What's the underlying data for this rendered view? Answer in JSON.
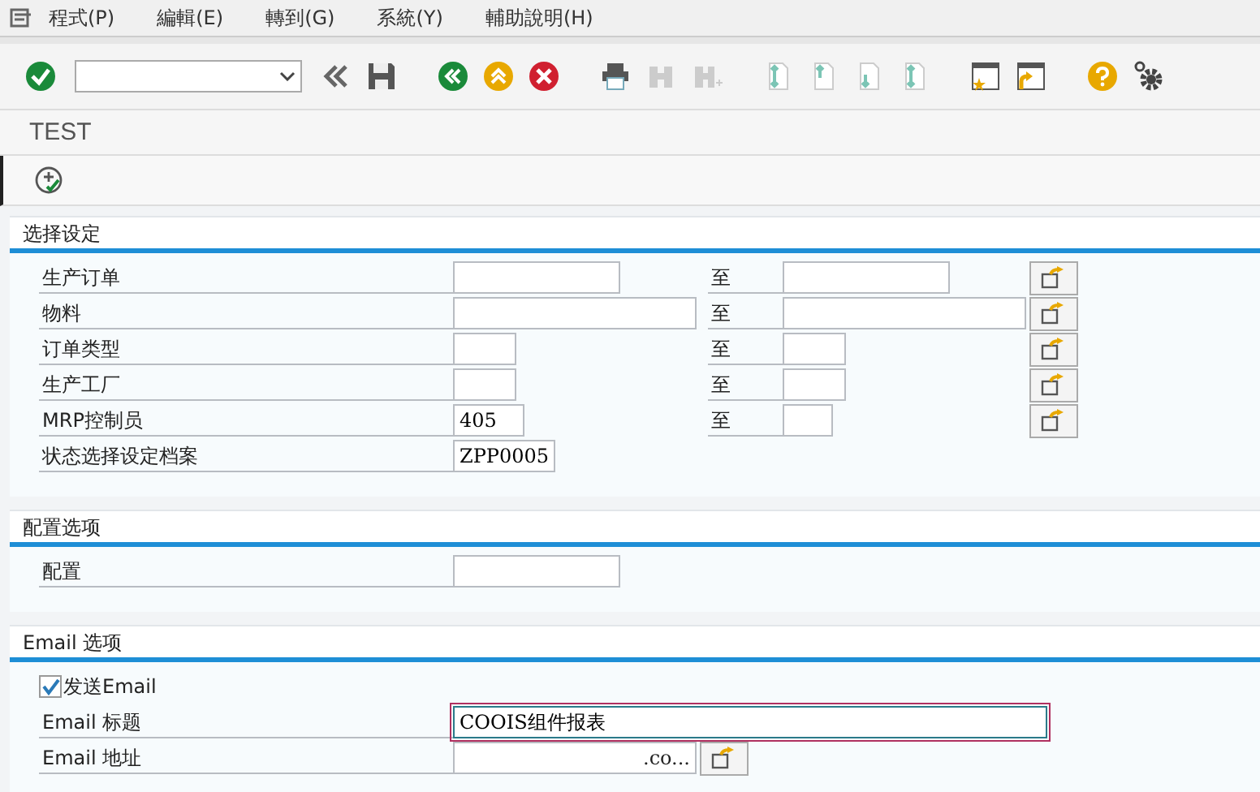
{
  "menu_bar": {
    "items": [
      "程式(P)",
      "編輯(E)",
      "轉到(G)",
      "系統(Y)",
      "輔助說明(H)"
    ]
  },
  "title": "TEST",
  "sections": [
    {
      "title": "选择设定",
      "rows": [
        {
          "kind": "range",
          "label": "生产订单",
          "value": "",
          "to_label": "至",
          "to_value": ""
        },
        {
          "kind": "range",
          "label": "物料",
          "value": "",
          "to_label": "至",
          "to_value": ""
        },
        {
          "kind": "range",
          "label": "订单类型",
          "value": "",
          "to_label": "至",
          "to_value": ""
        },
        {
          "kind": "range",
          "label": "生产工厂",
          "value": "",
          "to_label": "至",
          "to_value": ""
        },
        {
          "kind": "range",
          "label": "MRP控制员",
          "value": "405",
          "to_label": "至",
          "to_value": ""
        },
        {
          "kind": "field",
          "label": "状态选择设定档案",
          "value": "ZPP0005"
        }
      ]
    },
    {
      "title": "配置选项",
      "rows": [
        {
          "kind": "field",
          "label": "配置",
          "value": ""
        }
      ]
    },
    {
      "title": "Email 选项",
      "rows": [
        {
          "kind": "checkbox",
          "label": "发送Email",
          "checked": true
        },
        {
          "kind": "field",
          "label": "Email 标题",
          "value": "COOIS组件报表",
          "focused": true
        },
        {
          "kind": "multi",
          "label": "Email 地址",
          "value": ".co..."
        }
      ]
    }
  ]
}
